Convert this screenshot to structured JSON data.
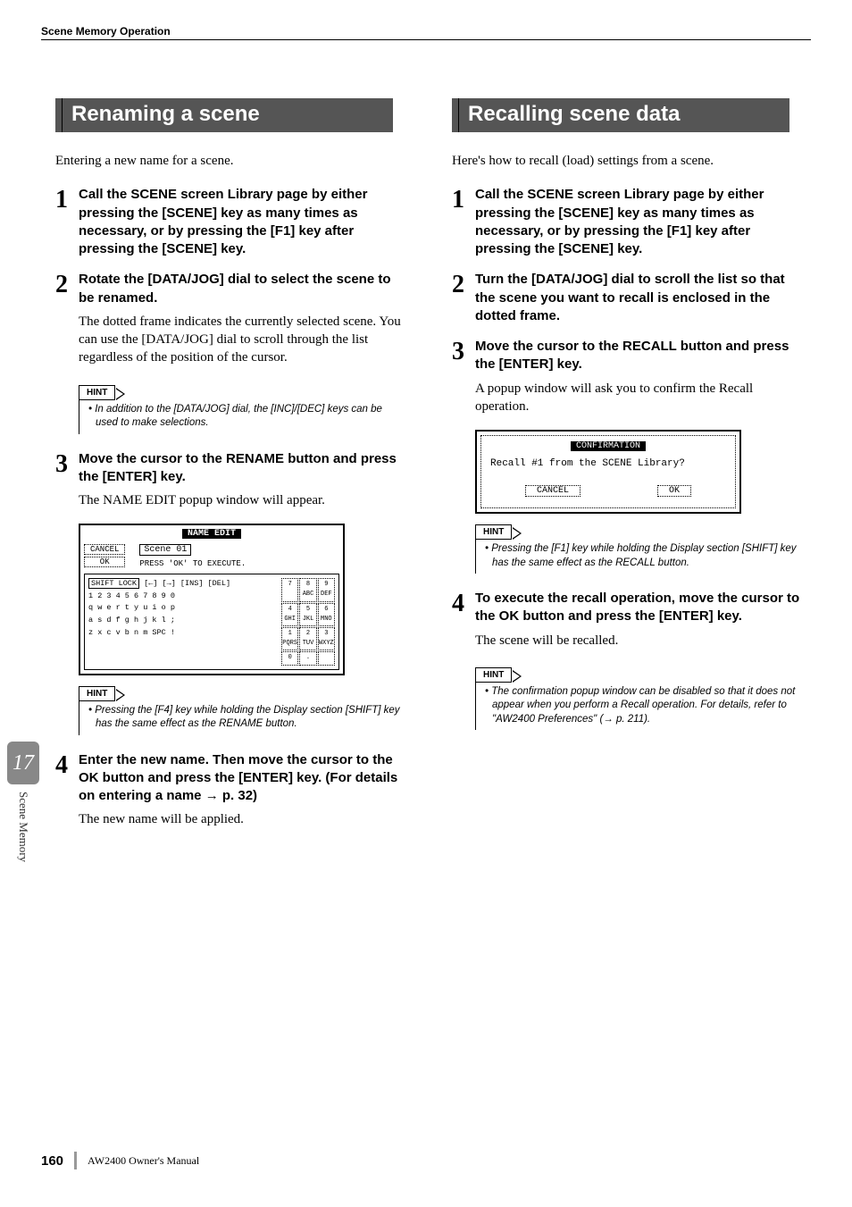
{
  "header": "Scene Memory Operation",
  "chapter_number": "17",
  "chapter_label": "Scene Memory",
  "page_number": "160",
  "manual_title": "AW2400  Owner's Manual",
  "left": {
    "heading": "Renaming a scene",
    "intro": "Entering a new name for a scene.",
    "steps": [
      {
        "num": "1",
        "title": "Call the SCENE screen Library page by either pressing the [SCENE] key as many times as necessary, or by pressing the [F1] key after pressing the [SCENE] key."
      },
      {
        "num": "2",
        "title": "Rotate the [DATA/JOG] dial to select the scene to be renamed.",
        "body": "The dotted frame indicates the currently selected scene. You can use the [DATA/JOG] dial to scroll through the list regardless of the position of the cursor."
      },
      {
        "num": "3",
        "title": "Move the cursor to the RENAME button and press the [ENTER] key.",
        "body": "The NAME EDIT popup window will appear."
      },
      {
        "num": "4",
        "title": "Enter the new name. Then move the cursor to the OK button and press the [ENTER] key. (For details on entering a name → p. 32)",
        "body": "The new name will be applied."
      }
    ],
    "hint1": {
      "label": "HINT",
      "text": "• In addition to the [DATA/JOG] dial, the [INC]/[DEC] keys can be used to make selections."
    },
    "hint2": {
      "label": "HINT",
      "text": "• Pressing the [F4] key while holding the Display section [SHIFT] key has the same effect as the RENAME button."
    },
    "name_edit": {
      "title": "NAME EDIT",
      "cancel": "CANCEL",
      "ok": "OK",
      "scene_name": "Scene 01",
      "press_ok": "PRESS 'OK' TO EXECUTE.",
      "shift_lock": "SHIFT LOCK",
      "row_top": "[←] [→] [INS] [DEL]",
      "row_nums": "1 2 3 4 5 6 7 8 9 0",
      "row_q": "q w e r t y u i o p",
      "row_a": "a s d f g h j k l ;",
      "row_z": "z x c v b n m  SPC  !",
      "pad": [
        "7",
        "8 ABC",
        "9 DEF",
        "4 GHI",
        "5 JKL",
        "6 MNO",
        "1 PQRS",
        "2 TUV",
        "3 WXYZ",
        "0",
        ".",
        ""
      ]
    }
  },
  "right": {
    "heading": "Recalling scene data",
    "intro": "Here's how to recall (load) settings from a scene.",
    "steps": [
      {
        "num": "1",
        "title": "Call the SCENE screen Library page by either pressing the [SCENE] key as many times as necessary, or by pressing the [F1] key after pressing the [SCENE] key."
      },
      {
        "num": "2",
        "title": "Turn the [DATA/JOG] dial to scroll the list so that the scene you want to recall is enclosed in the dotted frame."
      },
      {
        "num": "3",
        "title": "Move the cursor to the RECALL button and press the [ENTER] key.",
        "body": "A popup window will ask you to confirm the Recall operation."
      },
      {
        "num": "4",
        "title": "To execute the recall operation, move the cursor to the OK button and press the [ENTER] key.",
        "body": "The scene will be recalled."
      }
    ],
    "hint1": {
      "label": "HINT",
      "text": "• Pressing the [F1] key while holding the Display section [SHIFT] key has the same effect as the RECALL button."
    },
    "hint2": {
      "label": "HINT",
      "text": "• The confirmation popup window can be disabled so that it does not appear when you perform a Recall operation. For details, refer to \"AW2400 Preferences\" (→ p. 211)."
    },
    "confirmation": {
      "title": "CONFIRMATION",
      "message": "Recall #1 from the SCENE Library?",
      "cancel": "CANCEL",
      "ok": "OK"
    }
  }
}
